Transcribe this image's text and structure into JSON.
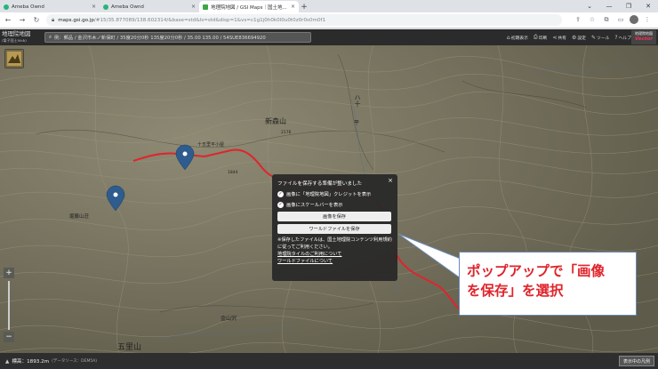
{
  "browser": {
    "tabs": [
      {
        "title": "Ameba Ownd",
        "active": false
      },
      {
        "title": "Ameba Ownd",
        "active": false
      },
      {
        "title": "地理院地図 / GSI Maps｜国土地...",
        "active": true
      }
    ],
    "new_tab_symbol": "+",
    "window_controls": [
      "⌄",
      "—",
      "❐",
      "✕"
    ],
    "url_host": "maps.gsi.go.jp",
    "url_path": "/#15/35.877089/138.602314/&base=std&ls=std&disp=1&vs=c1g1j0h0k0l0u0t0z0r0s0m0f1"
  },
  "app": {
    "logo_main": "地理院地図",
    "logo_sub": "(電子国土Web)",
    "search_text": "例：郵品 / 金沢市木ノ新保町 / 35度20分0秒 135度20分0秒 / 35.00 135.00 / 54SUE836694920",
    "tools": [
      {
        "label": "初期表示",
        "icon": "home-icon",
        "glyph": "⌂"
      },
      {
        "label": "印刷",
        "icon": "print-icon",
        "glyph": "⎙"
      },
      {
        "label": "共有",
        "icon": "share-icon",
        "glyph": "⋖"
      },
      {
        "label": "設定",
        "icon": "gear-icon",
        "glyph": "⚙"
      },
      {
        "label": "ツール",
        "icon": "tool-icon",
        "glyph": "✎"
      },
      {
        "label": "ヘルプ",
        "icon": "help-icon",
        "glyph": "?"
      }
    ],
    "vector_badge_top": "地理院地図",
    "vector_badge_bottom": "Vector",
    "zoom_in": "+",
    "zoom_out": "−",
    "scale_label": "500 m"
  },
  "map_labels": {
    "peak_new_forest": "新森山",
    "hut": "十五里平小屋",
    "peak_left": "堀藤山荘",
    "kana_h": "ハ十",
    "kana_f": "平",
    "elev_2176": "2176",
    "elev_1844": "1844",
    "river": "金山沢",
    "bottom_peak": "五里山"
  },
  "popup": {
    "title": "ファイルを保存する準備が整いました",
    "close": "×",
    "option1": "画像に「地理院地図」クレジットを表示",
    "option2": "画像にスケールバーを表示",
    "save_image": "画像を保存",
    "save_world": "ワールドファイルを保存",
    "note": "※保存したファイルは、国土地理院コンテンツ利用規約に従ってご利用ください。",
    "link1": "地理院タイルのご利用について",
    "link2": "ワールドファイルについて"
  },
  "callout": {
    "line1": "ポップアップで「画像",
    "line2": "を保存」を選択"
  },
  "bottom": {
    "elevation": "標高：1893.2m",
    "source": "(データソース：DEM5A)",
    "legend_button": "表示中の凡例"
  },
  "colors": {
    "route": "#e0242c",
    "callout_text": "#e0242c",
    "map_bg": "#7a7562"
  }
}
